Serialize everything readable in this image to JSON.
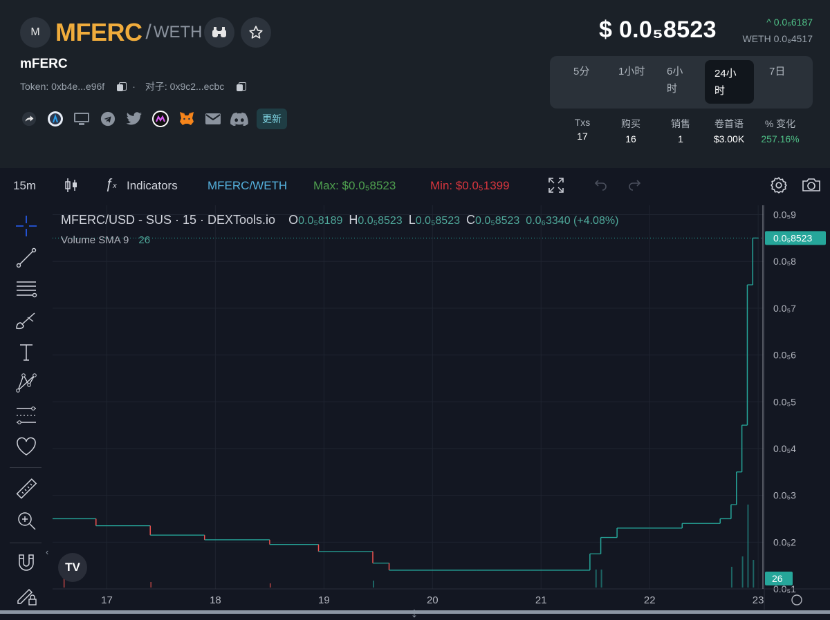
{
  "header": {
    "logo_letter": "M",
    "symbol": "MFERC",
    "slash": "/",
    "quote": "WETH",
    "token_name": "mFERC",
    "token_addr": "Token: 0xb4e...e96f",
    "dot": "·",
    "pair_addr": "对子: 0x9c2...ecbc",
    "update_label": "更新",
    "price": "$ 0.0₅8523",
    "price_change": "^ 0.0₅6187",
    "price_weth": "WETH 0.0₈4517"
  },
  "timeframes": [
    "5分",
    "1小时",
    "6小\n时",
    "24小\n时",
    "7日"
  ],
  "active_timeframe": "24小时",
  "stats": [
    {
      "label": "Txs",
      "value": "17"
    },
    {
      "label": "购买",
      "value": "16"
    },
    {
      "label": "销售",
      "value": "1"
    },
    {
      "label": "卷首语",
      "value": "$3.00K"
    },
    {
      "label": "% 变化",
      "value": "257.16%"
    }
  ],
  "toolbar": {
    "interval": "15m",
    "indicators": "Indicators",
    "pair": "MFERC/WETH",
    "max": "Max: $0.0₅8523",
    "min": "Min: $0.0₅1399"
  },
  "legend": {
    "symbol": "MFERC/USD - SUS · 15 · DEXTools.io",
    "o_label": "O",
    "o": "0.0₅8189",
    "h_label": "H",
    "h": "0.0₅8523",
    "l_label": "L",
    "l": "0.0₅8523",
    "c_label": "C",
    "c": "0.0₅8523",
    "change": "0.0₆3340 (+4.08%)",
    "volume_label": "Volume SMA 9",
    "volume_value": "26"
  },
  "colors": {
    "up": "#26a69a",
    "down": "#ef5350",
    "accent": "#f0ac3c",
    "positive": "#4fbf86"
  },
  "chart_data": {
    "type": "line",
    "title": "MFERC/USD - SUS · 15 · DEXTools.io",
    "y_ticks": [
      "0.0₅9",
      "0.0₅8",
      "0.0₅7",
      "0.0₅6",
      "0.0₅5",
      "0.0₅4",
      "0.0₅3",
      "0.0₅2",
      "0.0₅1"
    ],
    "x_ticks": [
      "17",
      "18",
      "19",
      "20",
      "21",
      "22",
      "23"
    ],
    "last_price_label": "0.0₅8523",
    "last_volume_label": "26",
    "ylim": [
      1e-06,
      9.2e-06
    ],
    "x": [
      16.5,
      16.9,
      17.4,
      17.9,
      18.5,
      18.95,
      19.45,
      19.6,
      20.4,
      20.9,
      21.45,
      21.55,
      21.7,
      22.0,
      22.3,
      22.65,
      22.75,
      22.8,
      22.85,
      22.9,
      22.95
    ],
    "values": [
      2.5e-06,
      2.35e-06,
      2.15e-06,
      2.05e-06,
      1.95e-06,
      1.8e-06,
      1.55e-06,
      1.4e-06,
      1.4e-06,
      1.4e-06,
      1.75e-06,
      2.1e-06,
      2.3e-06,
      2.3e-06,
      2.4e-06,
      2.5e-06,
      2.8e-06,
      3.5e-06,
      4.5e-06,
      7.5e-06,
      8.5e-06
    ]
  }
}
